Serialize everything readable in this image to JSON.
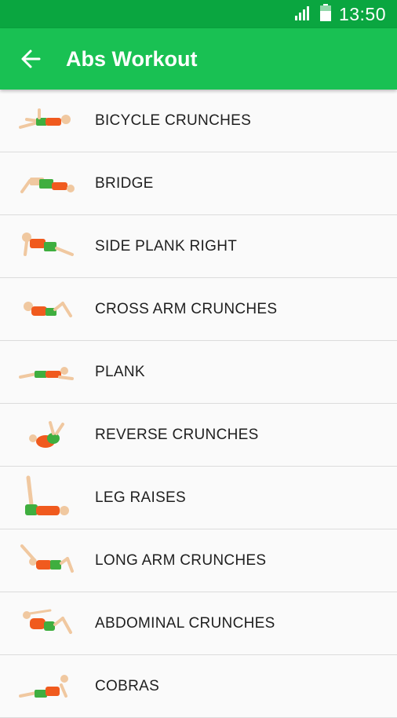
{
  "status_bar": {
    "time": "13:50"
  },
  "app_bar": {
    "title": "Abs Workout"
  },
  "colors": {
    "status_bar": "#0aa640",
    "app_bar": "#19c153",
    "shirt": "#f05a1e",
    "shorts": "#3fae3f",
    "skin": "#f0c8a0"
  },
  "exercises": [
    {
      "label": "BICYCLE CRUNCHES",
      "icon": "bicycle-crunches-icon"
    },
    {
      "label": "BRIDGE",
      "icon": "bridge-icon"
    },
    {
      "label": "SIDE PLANK RIGHT",
      "icon": "side-plank-right-icon"
    },
    {
      "label": "CROSS ARM CRUNCHES",
      "icon": "cross-arm-crunches-icon"
    },
    {
      "label": "PLANK",
      "icon": "plank-icon"
    },
    {
      "label": "REVERSE CRUNCHES",
      "icon": "reverse-crunches-icon"
    },
    {
      "label": "LEG RAISES",
      "icon": "leg-raises-icon"
    },
    {
      "label": "LONG ARM CRUNCHES",
      "icon": "long-arm-crunches-icon"
    },
    {
      "label": "ABDOMINAL CRUNCHES",
      "icon": "abdominal-crunches-icon"
    },
    {
      "label": "COBRAS",
      "icon": "cobras-icon"
    }
  ]
}
